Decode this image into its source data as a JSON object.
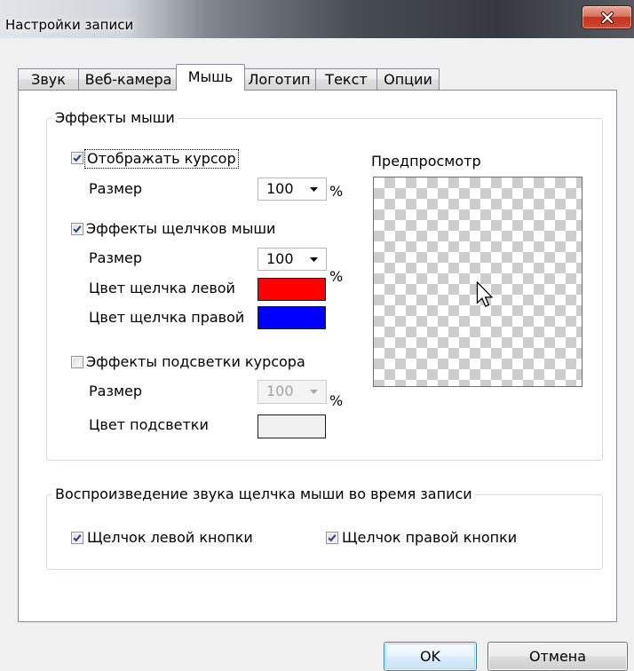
{
  "window": {
    "title": "Настройки записи",
    "close_icon": "close-icon"
  },
  "tabs": [
    {
      "label": "Звук",
      "selected": false
    },
    {
      "label": "Веб-камера",
      "selected": false
    },
    {
      "label": "Мышь",
      "selected": true
    },
    {
      "label": "Логотип",
      "selected": false
    },
    {
      "label": "Текст",
      "selected": false
    },
    {
      "label": "Опции",
      "selected": false
    }
  ],
  "mouse_effects": {
    "title": "Эффекты мыши",
    "show_cursor": {
      "label": "Отображать курсор",
      "checked": true,
      "size_label": "Размер",
      "size": "100",
      "unit": "%"
    },
    "click_effects": {
      "label": "Эффекты щелчков мыши",
      "checked": true,
      "size_label": "Размер",
      "size": "100",
      "unit": "%",
      "left_color_label": "Цвет щелчка левой",
      "left_color": "#ff0000",
      "right_color_label": "Цвет щелчка правой",
      "right_color": "#0000ff"
    },
    "highlight": {
      "label": "Эффекты подсветки курсора",
      "checked": false,
      "size_label": "Размер",
      "size": "100",
      "size_enabled": false,
      "unit": "%",
      "color_label": "Цвет подсветки",
      "color": "#f0f0f0"
    }
  },
  "preview": {
    "label": "Предпросмотр",
    "cursor_icon": "arrow-cursor-icon"
  },
  "click_sound": {
    "title": "Воспроизведение звука щелчка мыши во время записи",
    "left": {
      "label": "Щелчок левой кнопки",
      "checked": true
    },
    "right": {
      "label": "Щелчок правой кнопки",
      "checked": true
    }
  },
  "buttons": {
    "ok": "OK",
    "cancel": "Отмена"
  },
  "theme": {
    "accent": "#3c7fb1",
    "close_red": "#c3341f",
    "check_color": "#2a3f86"
  }
}
